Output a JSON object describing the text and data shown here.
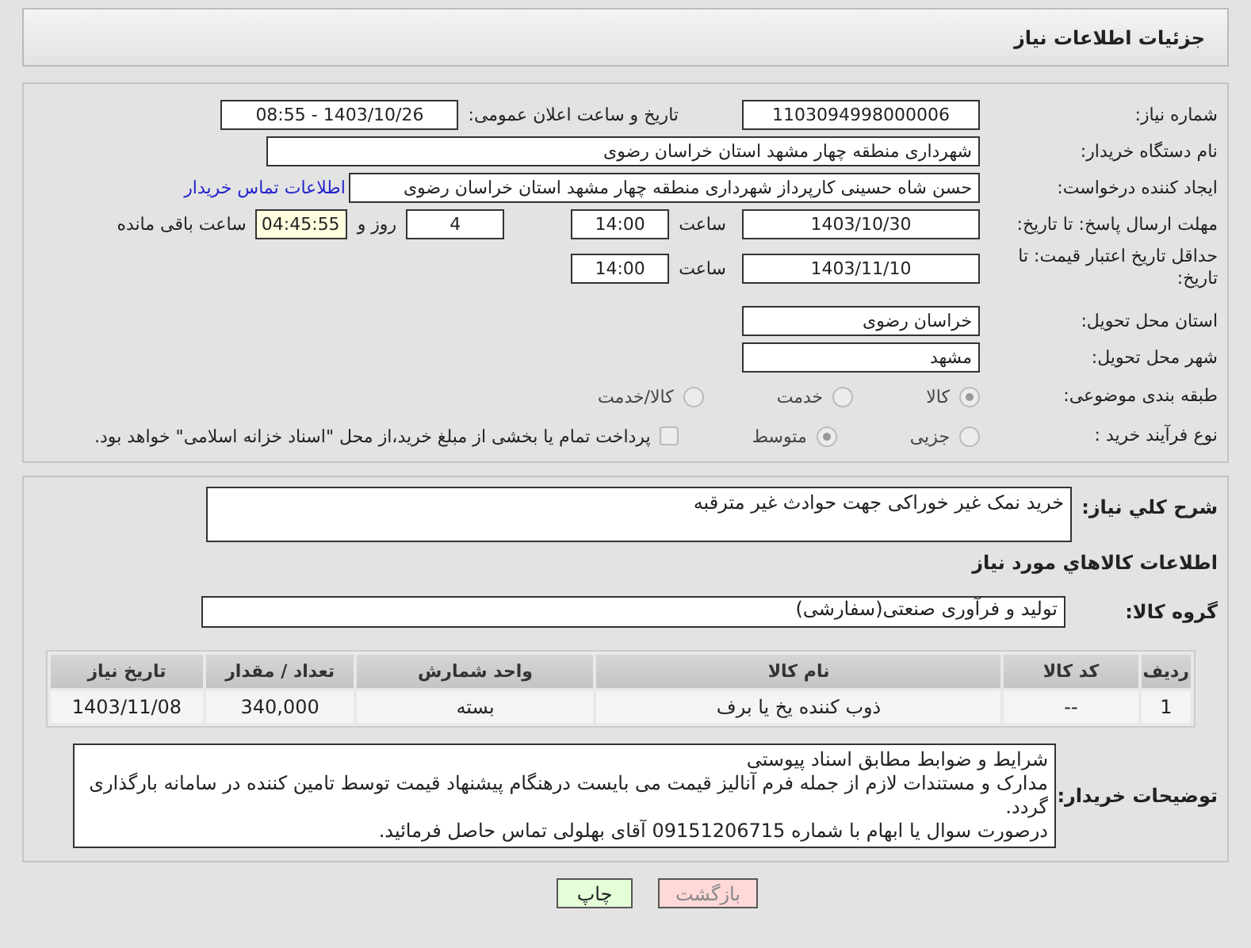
{
  "header": {
    "title": "جزئیات اطلاعات نیاز"
  },
  "details": {
    "need_number": {
      "label": "شماره نیاز:",
      "value": "1103094998000006"
    },
    "announce": {
      "label": "تاریخ و ساعت اعلان عمومی:",
      "value": "1403/10/26 - 08:55"
    },
    "buyer_org": {
      "label": "نام دستگاه خریدار:",
      "value": "شهرداری منطقه چهار مشهد استان خراسان رضوی"
    },
    "requester": {
      "label": "ایجاد کننده درخواست:",
      "value": "حسن شاه حسینی کارپرداز شهرداری منطقه چهار مشهد استان خراسان رضوی",
      "link": "اطلاعات تماس خریدار"
    },
    "reply_deadline": {
      "label": "مهلت ارسال پاسخ: تا تاریخ:",
      "date": "1403/10/30",
      "time_label": "ساعت",
      "time": "14:00",
      "days": "4",
      "days_label": "روز و",
      "remaining": "04:45:55",
      "remaining_label": "ساعت باقی مانده"
    },
    "price_validity": {
      "label": "حداقل تاریخ اعتبار قیمت: تا تاریخ:",
      "date": "1403/11/10",
      "time_label": "ساعت",
      "time": "14:00"
    },
    "province": {
      "label": "استان محل تحویل:",
      "value": "خراسان رضوی"
    },
    "city": {
      "label": "شهر محل تحویل:",
      "value": "مشهد"
    },
    "category": {
      "label": "طبقه بندی موضوعی:",
      "options": [
        {
          "label": "کالا",
          "selected": true
        },
        {
          "label": "خدمت",
          "selected": false
        },
        {
          "label": "کالا/خدمت",
          "selected": false
        }
      ]
    },
    "process": {
      "label": "نوع فرآیند خرید :",
      "options": [
        {
          "label": "جزیی",
          "selected": false
        },
        {
          "label": "متوسط",
          "selected": true
        }
      ],
      "payment": {
        "label": "پرداخت تمام یا بخشی از مبلغ خرید،از محل \"اسناد خزانه اسلامی\" خواهد بود.",
        "checked": false
      }
    }
  },
  "goods": {
    "description": {
      "label": "شرح کلي نياز:",
      "value": "خرید نمک غیر خوراکی جهت حوادث غیر مترقبه"
    },
    "section_title": "اطلاعات کالاهاي مورد نياز",
    "group": {
      "label": "گروه کالا:",
      "value": "تولید و فرآوری صنعتی(سفارشی)"
    },
    "table": {
      "columns": [
        "ردیف",
        "کد کالا",
        "نام کالا",
        "واحد شمارش",
        "تعداد / مقدار",
        "تاریخ نیاز"
      ],
      "rows": [
        [
          "1",
          "--",
          "ذوب کننده یخ یا برف",
          "بسته",
          "340,000",
          "1403/11/08"
        ]
      ]
    },
    "notes": {
      "label": "توضیحات خریدار:",
      "value": "شرایط و ضوابط مطابق اسناد پیوستی\nمدارک و مستندات لازم از جمله فرم آنالیز قیمت می بایست درهنگام پیشنهاد قیمت توسط تامین کننده در سامانه بارگذاری گردد.\nدرصورت سوال یا ابهام با شماره 09151206715 آقای بهلولی تماس حاصل فرمائید."
    }
  },
  "buttons": [
    {
      "label": "بازگشت",
      "kind": "back"
    },
    {
      "label": "چاپ",
      "kind": "print"
    }
  ]
}
